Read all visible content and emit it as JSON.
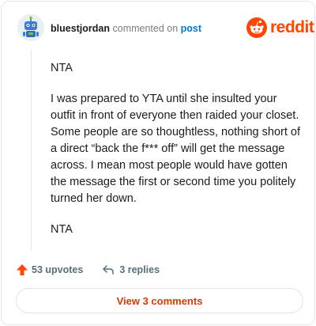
{
  "comment": {
    "username": "bluestjordan",
    "action_text": " commented on ",
    "post_link_text": "post",
    "avatar_icon": "robot-avatar-icon",
    "paragraphs": [
      "NTA",
      "I was prepared to YTA until she insulted your outfit in front of everyone then raided your closet. Some people are so thoughtless, nothing short of a direct “back the f*** off” will get the message across. I mean most people would have gotten the message the first or second time you politely turned her down.",
      "NTA"
    ]
  },
  "brand": {
    "name": "reddit",
    "icon": "reddit-snoo-icon",
    "color": "#ff4500"
  },
  "actions": {
    "upvotes": "53 upvotes",
    "upvote_icon": "upvote-arrow-icon",
    "upvote_color": "#ff4500",
    "replies": "3 replies",
    "reply_icon": "reply-arrow-icon"
  },
  "footer": {
    "view_comments_label": "View 3 comments",
    "accent_color": "#d93a00"
  }
}
